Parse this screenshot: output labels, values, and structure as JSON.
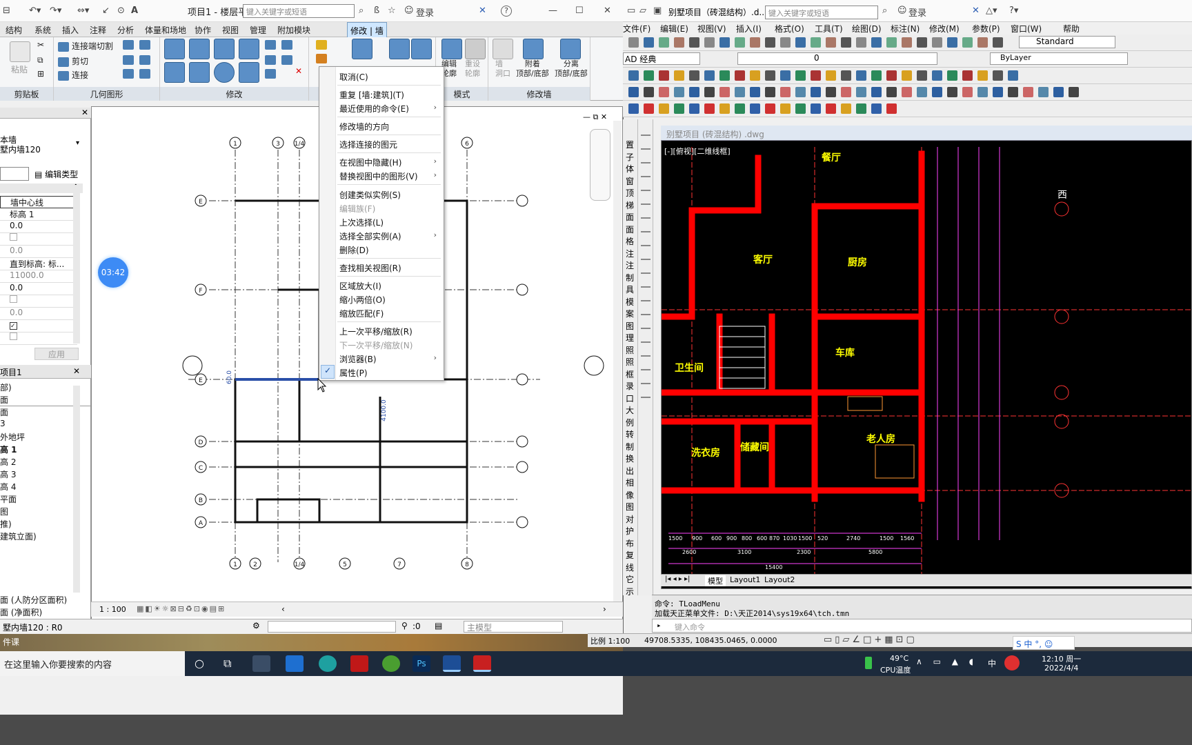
{
  "revit": {
    "title": "项目1 - 楼层平面...",
    "search_placeholder": "键入关键字或短语",
    "login": "登录",
    "help": "?",
    "tabs": [
      "结构",
      "系统",
      "插入",
      "注释",
      "分析",
      "体量和场地",
      "协作",
      "视图",
      "管理",
      "附加模块"
    ],
    "active_tab": "修改 | 墙",
    "ribbon": {
      "clipboard_label": "剪贴板",
      "paste": "粘贴",
      "geometry_label": "几何图形",
      "join_cut": "连接端切割",
      "cut": "剪切",
      "join": "连接",
      "modify_label": "修改",
      "mode_label": "模式",
      "edit_profile": "编辑\n轮廓",
      "reset_profile": "重设\n轮廓",
      "modify_wall_label": "修改墙",
      "wall_opening": "墙\n洞口",
      "attach": "附着\n顶部/底部",
      "detach": "分离\n顶部/底部"
    },
    "properties": {
      "type_line1": "本墙",
      "type_line2": "墅内墙120",
      "edit_type": "编辑类型",
      "rows": [
        "墙中心线",
        "标高 1",
        "0.0",
        "",
        "0.0",
        "直到标高: 标...",
        "11000.0",
        "0.0",
        "",
        "0.0",
        "",
        ""
      ],
      "apply": "应用"
    },
    "browser": {
      "title": "项目1",
      "items": [
        "部)",
        "面",
        "面",
        "3",
        "外地坪",
        "高 1",
        "高 2",
        "高 3",
        "高 4",
        "平面",
        "图",
        "推)",
        "建筑立面)"
      ],
      "extra": [
        "面 (人防分区面积)",
        "面 (净面积)"
      ]
    },
    "timer": "03:42",
    "grid_top": [
      "1",
      "3",
      "1/4",
      "6"
    ],
    "grid_bottom": [
      "1",
      "2",
      "1/4",
      "5",
      "7",
      "8"
    ],
    "grid_left": [
      "E",
      "F",
      "E",
      "D",
      "C",
      "B",
      "A"
    ],
    "dim_text": "4100.0",
    "dim_text2": "60.0",
    "scale": "1 : 100",
    "status_text": "墅内墙120 : R0",
    "status_zero": ":0",
    "status_model": "主模型",
    "desktop_label": "件课"
  },
  "context_menu": {
    "items": [
      {
        "label": "取消(C)",
        "disabled": false,
        "arrow": false
      },
      {
        "label": "重复 [墙:建筑](T)",
        "disabled": false,
        "arrow": false
      },
      {
        "label": "最近使用的命令(E)",
        "disabled": false,
        "arrow": true
      },
      {
        "label": "修改墙的方向",
        "disabled": false,
        "arrow": false
      },
      {
        "label": "选择连接的图元",
        "disabled": false,
        "arrow": false
      },
      {
        "label": "在视图中隐藏(H)",
        "disabled": false,
        "arrow": true
      },
      {
        "label": "替换视图中的图形(V)",
        "disabled": false,
        "arrow": true
      },
      {
        "label": "创建类似实例(S)",
        "disabled": false,
        "arrow": false
      },
      {
        "label": "编辑族(F)",
        "disabled": true,
        "arrow": false
      },
      {
        "label": "上次选择(L)",
        "disabled": false,
        "arrow": false
      },
      {
        "label": "选择全部实例(A)",
        "disabled": false,
        "arrow": true
      },
      {
        "label": "删除(D)",
        "disabled": false,
        "arrow": false
      },
      {
        "label": "查找相关视图(R)",
        "disabled": false,
        "arrow": false
      },
      {
        "label": "区域放大(I)",
        "disabled": false,
        "arrow": false
      },
      {
        "label": "缩小两倍(O)",
        "disabled": false,
        "arrow": false
      },
      {
        "label": "缩放匹配(F)",
        "disabled": false,
        "arrow": false
      },
      {
        "label": "上一次平移/缩放(R)",
        "disabled": false,
        "arrow": false
      },
      {
        "label": "下一次平移/缩放(N)",
        "disabled": true,
        "arrow": false
      },
      {
        "label": "浏览器(B)",
        "disabled": false,
        "arrow": true
      },
      {
        "label": "属性(P)",
        "disabled": false,
        "arrow": false,
        "checked": true
      }
    ]
  },
  "acad": {
    "title": "别墅项目（砖混结构）.d...",
    "search_placeholder": "键入关键字或短语",
    "login": "登录",
    "menu": [
      "文件(F)",
      "编辑(E)",
      "视图(V)",
      "插入(I)",
      "格式(O)",
      "工具(T)",
      "绘图(D)",
      "标注(N)",
      "修改(M)",
      "参数(P)",
      "窗口(W)",
      "帮助"
    ],
    "workspace": "AD 经典",
    "text_style": "Standard",
    "layer_value": "0",
    "linetype": "ByLayer",
    "doc_title": "别墅项目 (砖混结构) .dwg",
    "view_label": "[-][俯视][二维线框]",
    "rooms": [
      "餐厅",
      "客厅",
      "厨房",
      "卫生间",
      "车库",
      "老人房",
      "储藏间",
      "洗衣房"
    ],
    "bottom_dims": [
      "1500",
      "900",
      "600",
      "900",
      "800",
      "600",
      "870",
      "1030",
      "1500",
      "520",
      "2740",
      "1500",
      "1560"
    ],
    "bottom_dims2": [
      "2600",
      "3100",
      "2300",
      "5800"
    ],
    "total_dim": "15400",
    "layout_tabs": [
      "模型",
      "Layout1",
      "Layout2"
    ],
    "cmd_line1": "命令: TLoadMenu",
    "cmd_line2": "加载天正菜单文件: D:\\天正2014\\sys19x64\\tch.tmn",
    "cmd_prompt": "键入命令",
    "scale_label": "比例 1:100",
    "coords": "49708.5335, 108435.0465, 0.0000",
    "left_tools": [
      "置",
      "子",
      "体",
      "窗",
      "顶",
      "梯",
      "面",
      "面",
      "格",
      "注",
      "注",
      "制",
      "具",
      "模",
      "案",
      "图",
      "理",
      "照",
      "照",
      "框",
      "录",
      "口",
      "大",
      "例",
      "转",
      "制",
      "换",
      "出",
      "相",
      "像",
      "图",
      "对",
      "护",
      "布",
      "复",
      "线",
      "它",
      "示"
    ],
    "right_label": "西"
  },
  "taskbar": {
    "search_placeholder": "在这里输入你要搜索的内容",
    "temp": "49°C",
    "temp_label": "CPU温度",
    "ime": "中",
    "time": "12:10 周一",
    "date": "2022/4/4"
  },
  "colors": {
    "revit_accent": "#cfe7ff",
    "acad_wall": "#ff0000",
    "acad_bg": "#000000",
    "taskbar": "#1c2a3c"
  }
}
